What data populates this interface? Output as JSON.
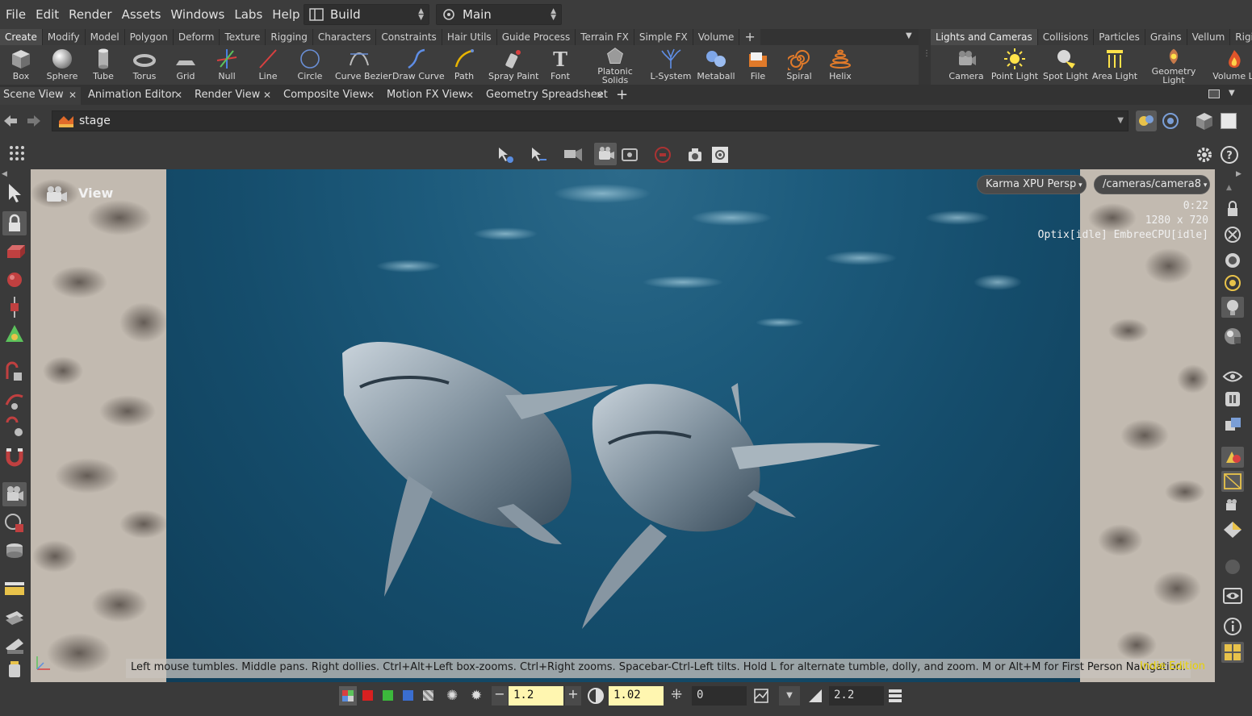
{
  "menubar": {
    "items": [
      "File",
      "Edit",
      "Render",
      "Assets",
      "Windows",
      "Labs",
      "Help"
    ],
    "desktop": "Build",
    "context": "Main"
  },
  "shelf_left": {
    "tabs": [
      "Create",
      "Modify",
      "Model",
      "Polygon",
      "Deform",
      "Texture",
      "Rigging",
      "Characters",
      "Constraints",
      "Hair Utils",
      "Guide Process",
      "Terrain FX",
      "Simple FX",
      "Volume"
    ],
    "tools": [
      "Box",
      "Sphere",
      "Tube",
      "Torus",
      "Grid",
      "Null",
      "Line",
      "Circle",
      "Curve Bezier",
      "Draw Curve",
      "Path",
      "Spray Paint",
      "Font",
      "Platonic",
      "Solids",
      "L-System",
      "Metaball",
      "File",
      "Spiral",
      "Helix"
    ]
  },
  "shelf_right": {
    "tabs": [
      "Lights and Cameras",
      "Collisions",
      "Particles",
      "Grains",
      "Vellum",
      "Rigid Bo"
    ],
    "tools": [
      "Camera",
      "Point Light",
      "Spot Light",
      "Area Light",
      "Geometry",
      "Light",
      "Volume Li"
    ]
  },
  "pane_tabs": [
    "Scene View",
    "Animation Editor",
    "Render View",
    "Composite View",
    "Motion FX View",
    "Geometry Spreadsheet"
  ],
  "pathbar": {
    "path": "stage"
  },
  "viewport": {
    "label": "View",
    "renderer": "Karma XPU  Persp",
    "camera": "/cameras/camera8",
    "time": "0:22",
    "resolution": "1280 x 720",
    "engines": "Optix[idle] EmbreeCPU[idle]",
    "hint": "Left mouse tumbles. Middle pans. Right dollies. Ctrl+Alt+Left box-zooms. Ctrl+Right zooms. Spacebar-Ctrl-Left tilts. Hold L for alternate tumble, dolly, and zoom. M or Alt+M for First Person Navigation.",
    "edition": "Indie Edition"
  },
  "bottom": {
    "exposure": "1.2",
    "gamma": "1.02",
    "offset": "0",
    "lut_gamma": "2.2"
  },
  "colors": {
    "accent_yellow": "#ffe24a",
    "edition_yellow": "#e8d200",
    "water": "#1d5b7c"
  }
}
